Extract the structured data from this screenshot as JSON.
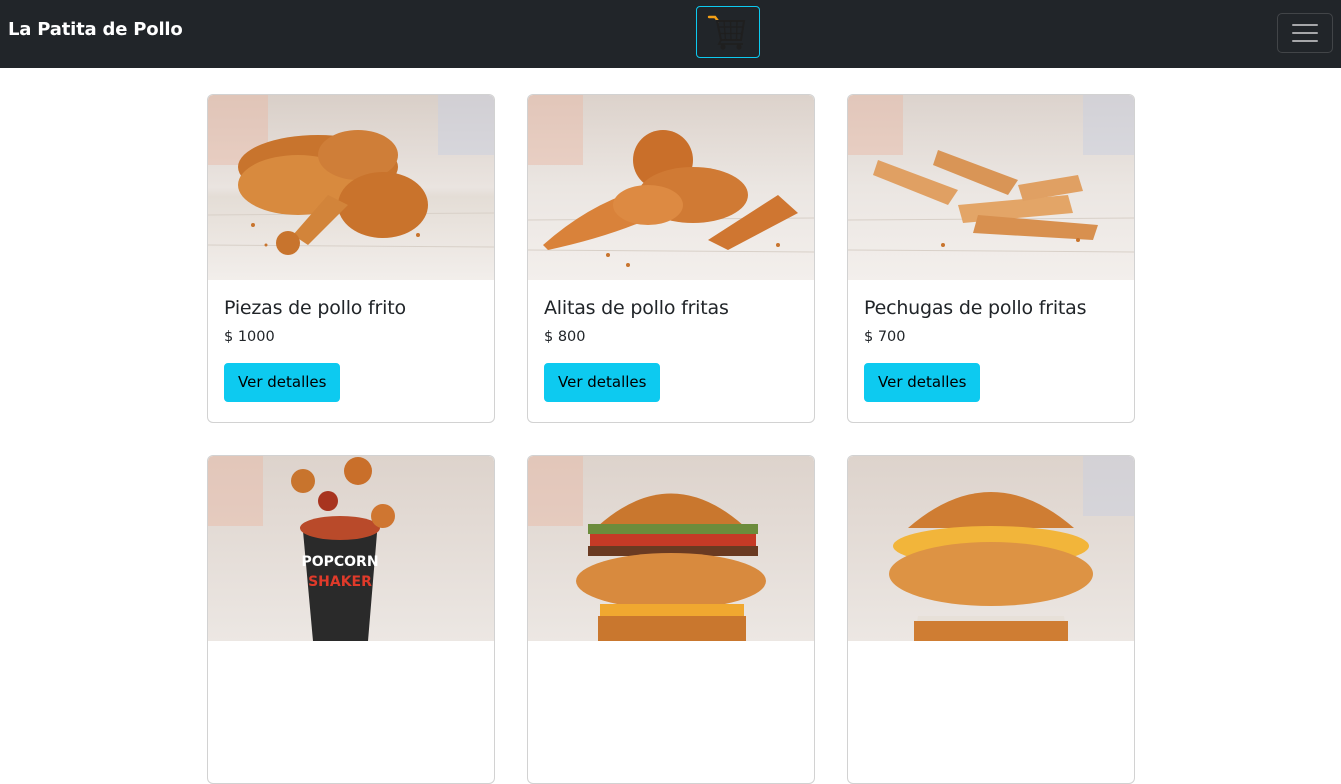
{
  "navbar": {
    "brand": "La Patita de Pollo",
    "cart_icon": "shopping-cart-icon",
    "menu_icon": "hamburger-menu-icon"
  },
  "colors": {
    "navbar_bg": "#212529",
    "accent": "#0dcaf0",
    "cart_orange": "#f4a016"
  },
  "products": [
    {
      "title": "Piezas de pollo frito",
      "price": "$ 1000",
      "button": "Ver detalles",
      "image": "fried-chicken-pieces"
    },
    {
      "title": "Alitas de pollo fritas",
      "price": "$ 800",
      "button": "Ver detalles",
      "image": "fried-chicken-wings"
    },
    {
      "title": "Pechugas de pollo fritas",
      "price": "$ 700",
      "button": "Ver detalles",
      "image": "fried-chicken-tenders"
    },
    {
      "title": "",
      "price": "",
      "button": "",
      "image": "popcorn-chicken-shaker"
    },
    {
      "title": "",
      "price": "",
      "button": "",
      "image": "bacon-chicken-burger"
    },
    {
      "title": "",
      "price": "",
      "button": "",
      "image": "cheese-chicken-burger"
    }
  ]
}
